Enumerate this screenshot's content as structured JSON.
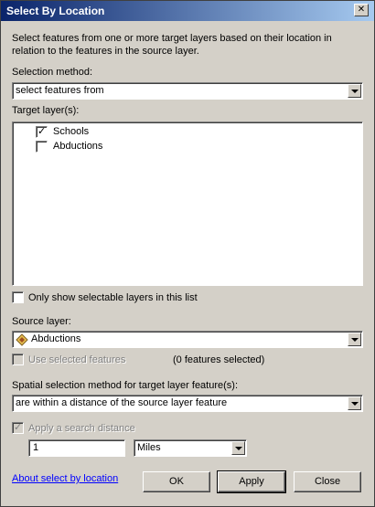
{
  "window": {
    "title": "Select By Location",
    "close_glyph": "✕"
  },
  "description": "Select features from one or more target layers based on their location in relation to the features in the source layer.",
  "selection_method": {
    "label": "Selection method:",
    "value": "select features from"
  },
  "target_layers": {
    "label": "Target layer(s):",
    "items": [
      {
        "label": "Schools",
        "checked": true
      },
      {
        "label": "Abductions",
        "checked": false
      }
    ]
  },
  "only_selectable": {
    "label": "Only show selectable layers in this list",
    "checked": false
  },
  "source_layer": {
    "label": "Source layer:",
    "value": "Abductions",
    "icon": "polygon-layer-icon"
  },
  "use_selected": {
    "label": "Use selected features",
    "count_text": "(0 features selected)"
  },
  "spatial_method": {
    "label": "Spatial selection method for target layer feature(s):",
    "value": "are within a distance of the source layer feature"
  },
  "search_distance": {
    "label": "Apply a search distance",
    "value": "1",
    "unit": "Miles"
  },
  "about_link": "About select by location",
  "buttons": {
    "ok": "OK",
    "apply": "Apply",
    "close": "Close"
  },
  "check_glyph": "✓"
}
